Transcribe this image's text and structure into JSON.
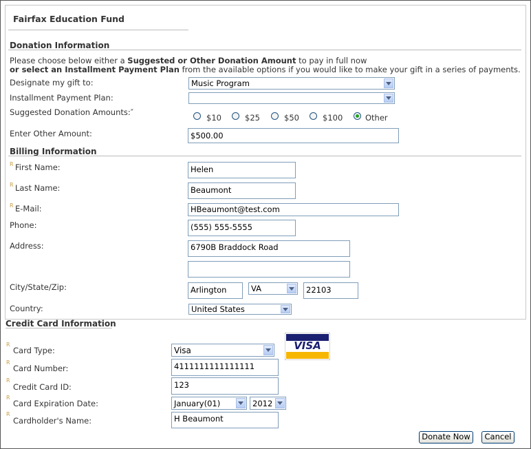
{
  "title": "Fairfax Education Fund",
  "donation": {
    "heading": "Donation Information",
    "intro_line1_pre": "Please choose below either a ",
    "intro_line1_bold": "Suggested or Other Donation Amount",
    "intro_line1_post": " to pay in full now",
    "intro_line2_bold": "or select an Installment Payment Plan",
    "intro_line2_post": " from the available options if you would like to make your gift in a series of payments.",
    "designate_label": "Designate my gift to:",
    "designate_value": "Music Program",
    "installment_label": "Installment Payment Plan:",
    "installment_value": "",
    "suggested_label": "Suggested Donation Amounts:″",
    "amounts": [
      "$10",
      "$25",
      "$50",
      "$100",
      "Other"
    ],
    "selected_amount": "Other",
    "other_label": "Enter Other Amount:",
    "other_value": "$500.00"
  },
  "billing": {
    "heading": "Billing Information",
    "req_marker": "R",
    "first_name_label": "First Name:",
    "first_name": "Helen",
    "last_name_label": "Last Name:",
    "last_name": "Beaumont",
    "email_label": "E-Mail:",
    "email": "HBeaumont@test.com",
    "phone_label": "Phone:",
    "phone": "(555) 555-5555",
    "address_label": "Address:",
    "address1": "6790B Braddock Road",
    "address2": "",
    "city_label": "City/State/Zip:",
    "city": "Arlington",
    "state": "VA",
    "zip": "22103",
    "country_label": "Country:",
    "country": "United States"
  },
  "credit": {
    "heading": "Credit Card Information",
    "card_type_label": "Card Type:",
    "card_type": "Visa",
    "card_number_label": "Card Number:",
    "card_number": "4111111111111111",
    "card_id_label": "Credit Card ID:",
    "card_id": "123",
    "expiration_label": "Card Expiration Date:",
    "exp_month": "January(01)",
    "exp_year": "2012",
    "holder_label": "Cardholder's Name:",
    "holder": "H Beaumont",
    "visa_logo_text": "VISA"
  },
  "buttons": {
    "donate": "Donate Now",
    "cancel": "Cancel"
  },
  "colors": {
    "border": "#7f9db9",
    "req": "#c8a04a",
    "radio_on": "#21a121",
    "visa_blue": "#1a1f71",
    "visa_gold": "#f7b600"
  }
}
